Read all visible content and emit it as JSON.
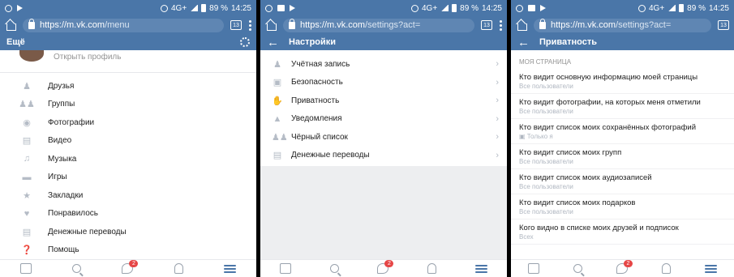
{
  "status": {
    "time": "14:25",
    "battery": "89 %",
    "network": "4G+"
  },
  "panel1": {
    "url": {
      "host": "https://m.vk.com",
      "path": "/menu"
    },
    "tab_count": "13",
    "title": "Ещё",
    "open_profile": "Открыть профиль",
    "menu": [
      {
        "label": "Друзья",
        "icon": "friends-icon"
      },
      {
        "label": "Группы",
        "icon": "groups-icon"
      },
      {
        "label": "Фотографии",
        "icon": "camera-icon"
      },
      {
        "label": "Видео",
        "icon": "video-icon"
      },
      {
        "label": "Музыка",
        "icon": "music-icon"
      },
      {
        "label": "Игры",
        "icon": "gamepad-icon"
      },
      {
        "label": "Закладки",
        "icon": "star-icon"
      },
      {
        "label": "Понравилось",
        "icon": "heart-icon"
      },
      {
        "label": "Денежные переводы",
        "icon": "card-icon"
      },
      {
        "label": "Помощь",
        "icon": "help-icon"
      }
    ]
  },
  "panel2": {
    "url": {
      "host": "https://m.vk.com",
      "path": "/settings?act="
    },
    "tab_count": "13",
    "title": "Настройки",
    "items": [
      {
        "label": "Учётная запись",
        "icon": "account-icon"
      },
      {
        "label": "Безопасность",
        "icon": "lock-icon"
      },
      {
        "label": "Приватность",
        "icon": "hand-icon"
      },
      {
        "label": "Уведомления",
        "icon": "bell-icon"
      },
      {
        "label": "Чёрный список",
        "icon": "blocked-users-icon"
      },
      {
        "label": "Денежные переводы",
        "icon": "card-icon"
      }
    ]
  },
  "panel3": {
    "url": {
      "host": "https://m.vk.com",
      "path": "/settings?act="
    },
    "tab_count": "13",
    "title": "Приватность",
    "section": "Моя страница",
    "items": [
      {
        "q": "Кто видит основную информацию моей страницы",
        "a": "Все пользователи"
      },
      {
        "q": "Кто видит фотографии, на которых меня отметили",
        "a": "Все пользователи"
      },
      {
        "q": "Кто видит список моих сохранённых фотографий",
        "a": "Только я"
      },
      {
        "q": "Кто видит список моих групп",
        "a": "Все пользователи"
      },
      {
        "q": "Кто видит список моих аудиозаписей",
        "a": "Все пользователи"
      },
      {
        "q": "Кто видит список моих подарков",
        "a": "Все пользователи"
      },
      {
        "q": "Кого видно в списке моих друзей и подписок",
        "a": "Всех"
      }
    ]
  },
  "nav": {
    "messages_badge": "2"
  },
  "colors": {
    "brand": "#4a76a8",
    "badge": "#e64646"
  }
}
